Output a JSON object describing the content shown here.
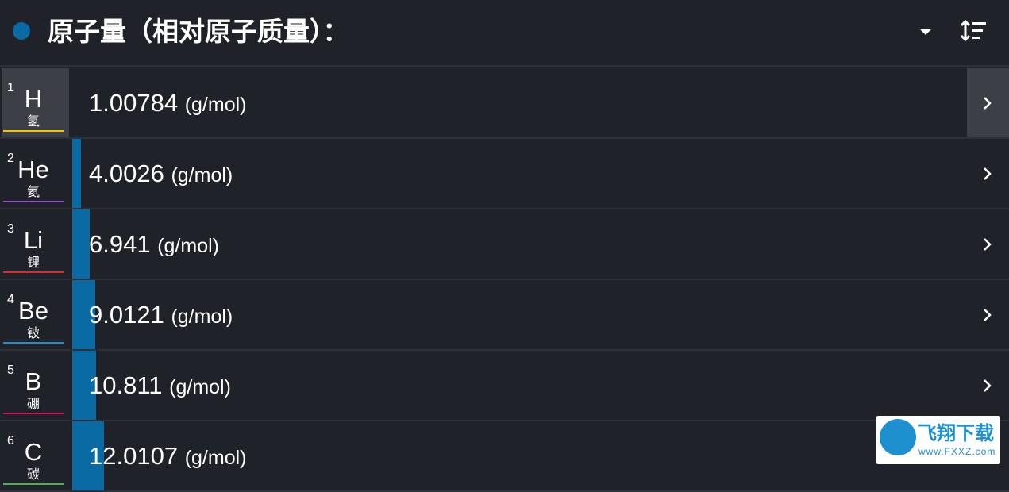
{
  "header": {
    "title": "原子量（相对原子质量）：",
    "accent_color": "#0a6aa3",
    "dropdown_icon": "triangle-down-icon",
    "sort_icon": "sort-icon"
  },
  "rows": [
    {
      "num": "1",
      "symbol": "H",
      "name": "氢",
      "value": "1.00784",
      "unit": "(g/mol)",
      "category_color": "#f5c400",
      "bar_fraction": 0.0,
      "selected": true
    },
    {
      "num": "2",
      "symbol": "He",
      "name": "氦",
      "value": "4.0026",
      "unit": "(g/mol)",
      "category_color": "#9c4dcc",
      "bar_fraction": 0.0094,
      "selected": false
    },
    {
      "num": "3",
      "symbol": "Li",
      "name": "锂",
      "value": "6.941",
      "unit": "(g/mol)",
      "category_color": "#d32f2f",
      "bar_fraction": 0.0192,
      "selected": false
    },
    {
      "num": "4",
      "symbol": "Be",
      "name": "铍",
      "value": "9.0121",
      "unit": "(g/mol)",
      "category_color": "#1e8fcf",
      "bar_fraction": 0.0261,
      "selected": false
    },
    {
      "num": "5",
      "symbol": "B",
      "name": "硼",
      "value": "10.811",
      "unit": "(g/mol)",
      "category_color": "#c2185b",
      "bar_fraction": 0.0263,
      "selected": false
    },
    {
      "num": "6",
      "symbol": "C",
      "name": "碳",
      "value": "12.0107",
      "unit": "(g/mol)",
      "category_color": "#4caf50",
      "bar_fraction": 0.0356,
      "selected": false
    }
  ],
  "watermark": {
    "name": "飞翔下载",
    "url": "www.FXXZ.com"
  }
}
